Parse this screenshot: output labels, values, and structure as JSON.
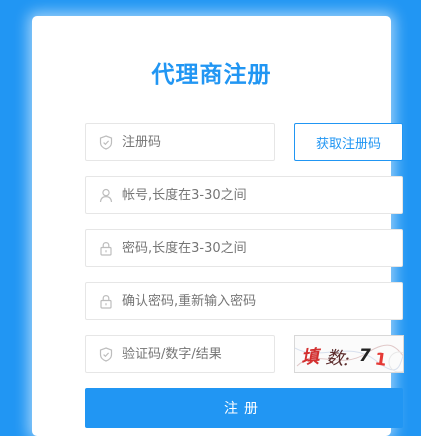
{
  "page": {
    "title": "代理商注册"
  },
  "form": {
    "reg_code": {
      "placeholder": "注册码",
      "icon": "shield-icon"
    },
    "get_code_button": "获取注册码",
    "account": {
      "placeholder": "帐号,长度在3-30之间",
      "icon": "user-icon"
    },
    "password": {
      "placeholder": "密码,长度在3-30之间",
      "icon": "lock-icon"
    },
    "confirm_password": {
      "placeholder": "确认密码,重新输入密码",
      "icon": "lock-icon"
    },
    "captcha_input": {
      "placeholder": "验证码/数字/结果",
      "icon": "shield-icon"
    },
    "captcha_image": {
      "text": "填 数: 7 1"
    },
    "submit_button": "注册"
  },
  "colors": {
    "background": "#2196f3",
    "accent": "#2196f3",
    "card": "#ffffff",
    "field_border": "#e6e6e6",
    "placeholder": "#757575"
  }
}
